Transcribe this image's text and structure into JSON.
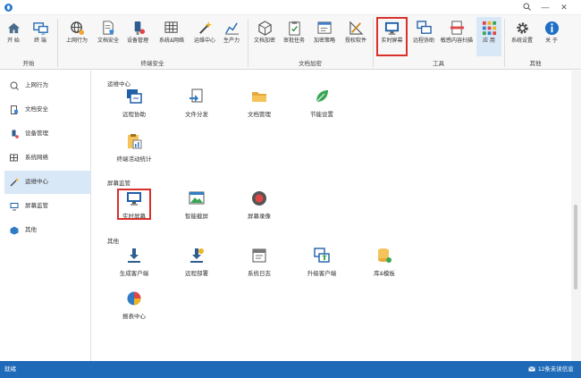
{
  "window": {
    "minimize_glyph": "—",
    "maximize_glyph": "☐",
    "close_glyph": "✕"
  },
  "ribbon": {
    "buttons": {
      "start": "开 始",
      "terminal": "终 端",
      "online_behavior": "上网行为",
      "doc_security": "文档安全",
      "device_mgmt": "设备管理",
      "system_network": "系统&网络",
      "ops_center": "运维中心",
      "productivity": "生产力",
      "doc_encrypt": "文档加密",
      "approval_task": "审批任务",
      "encrypt_policy": "加密策略",
      "auth_software": "授权软件",
      "realtime_screen": "实时屏幕",
      "remote_assist": "远程协助",
      "sensitive_scan": "敏感内容扫描",
      "apps": "应 用",
      "system_settings": "系统设置",
      "about": "关 于"
    },
    "groups": {
      "start": "开始",
      "terminal_security": "终端安全",
      "doc_encryption": "文档加密",
      "tools": "工具",
      "other": "其他"
    }
  },
  "sidebar": {
    "items": [
      {
        "label": "上网行为"
      },
      {
        "label": "文档安全"
      },
      {
        "label": "设备管理"
      },
      {
        "label": "系统网络"
      },
      {
        "label": "运维中心"
      },
      {
        "label": "屏幕监管"
      },
      {
        "label": "其他"
      }
    ]
  },
  "content": {
    "sections": {
      "ops": "运维中心",
      "screen": "屏幕监管",
      "other": "其他"
    },
    "ops_items": [
      "远程协助",
      "文件分发",
      "文档管理",
      "节能设置",
      "终端活动统计"
    ],
    "screen_items": [
      "实时屏幕",
      "智能截屏",
      "屏幕录像"
    ],
    "other_items": [
      "生成客户端",
      "远程部署",
      "系统日志",
      "升级客户端",
      "库&模板",
      "报表中心"
    ]
  },
  "status": {
    "left": "就绪",
    "messages": "12条未读信息"
  },
  "colors": {
    "accent": "#1e6ab8",
    "highlight": "#d9302c",
    "active": "#d9e8f7"
  }
}
